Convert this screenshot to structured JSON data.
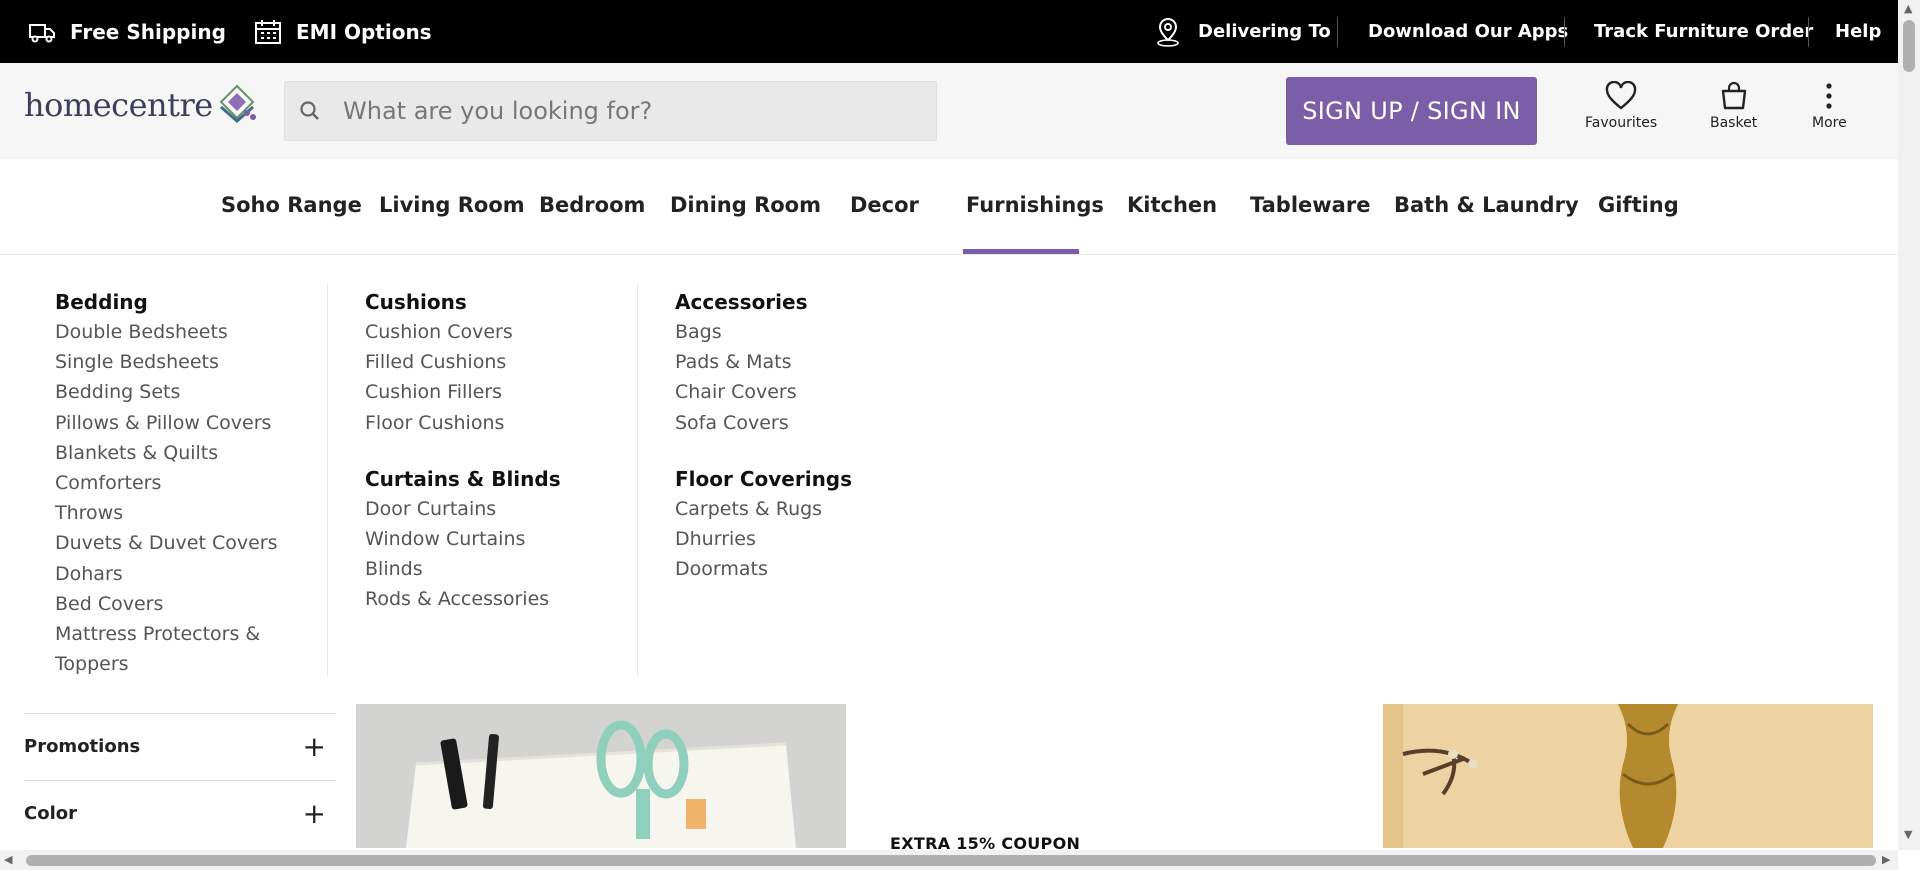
{
  "topbar": {
    "free_shipping": "Free Shipping",
    "emi_options": "EMI Options",
    "delivering_to": "Delivering To",
    "download_apps": "Download Our Apps",
    "track_order": "Track Furniture Order",
    "help": "Help"
  },
  "header": {
    "logo_text": "homecentre",
    "search_placeholder": "What are you looking for?",
    "signin_label": "SIGN UP / SIGN IN",
    "favourites_label": "Favourites",
    "basket_label": "Basket",
    "more_label": "More"
  },
  "categories": [
    "Soho Range",
    "Living Room",
    "Bedroom",
    "Dining Room",
    "Decor",
    "Furnishings",
    "Kitchen",
    "Tableware",
    "Bath & Laundry",
    "Gifting"
  ],
  "active_category": "Furnishings",
  "mega_menu": {
    "col1": {
      "groups": [
        {
          "heading": "Bedding",
          "links": [
            "Double Bedsheets",
            "Single Bedsheets",
            "Bedding Sets",
            "Pillows & Pillow Covers",
            "Blankets & Quilts",
            "Comforters",
            "Throws",
            "Duvets & Duvet Covers",
            "Dohars",
            "Bed Covers",
            "Mattress Protectors &",
            "Toppers"
          ]
        }
      ]
    },
    "col2": {
      "groups": [
        {
          "heading": "Cushions",
          "links": [
            "Cushion Covers",
            "Filled Cushions",
            "Cushion Fillers",
            "Floor Cushions"
          ]
        },
        {
          "heading": "Curtains & Blinds",
          "links": [
            "Door Curtains",
            "Window Curtains",
            "Blinds",
            "Rods & Accessories"
          ]
        }
      ]
    },
    "col3": {
      "groups": [
        {
          "heading": "Accessories",
          "links": [
            "Bags",
            "Pads & Mats",
            "Chair Covers",
            "Sofa Covers"
          ]
        },
        {
          "heading": "Floor Coverings",
          "links": [
            "Carpets & Rugs",
            "Dhurries",
            "Doormats"
          ]
        }
      ]
    }
  },
  "filters": {
    "promotions": "Promotions",
    "color": "Color",
    "expand_symbol": "+"
  },
  "promo": {
    "coupon_text": "EXTRA 15% COUPON"
  },
  "colors": {
    "accent": "#7b5ea7",
    "topbar_bg": "#000000",
    "header_bg": "#f6f6f6"
  }
}
